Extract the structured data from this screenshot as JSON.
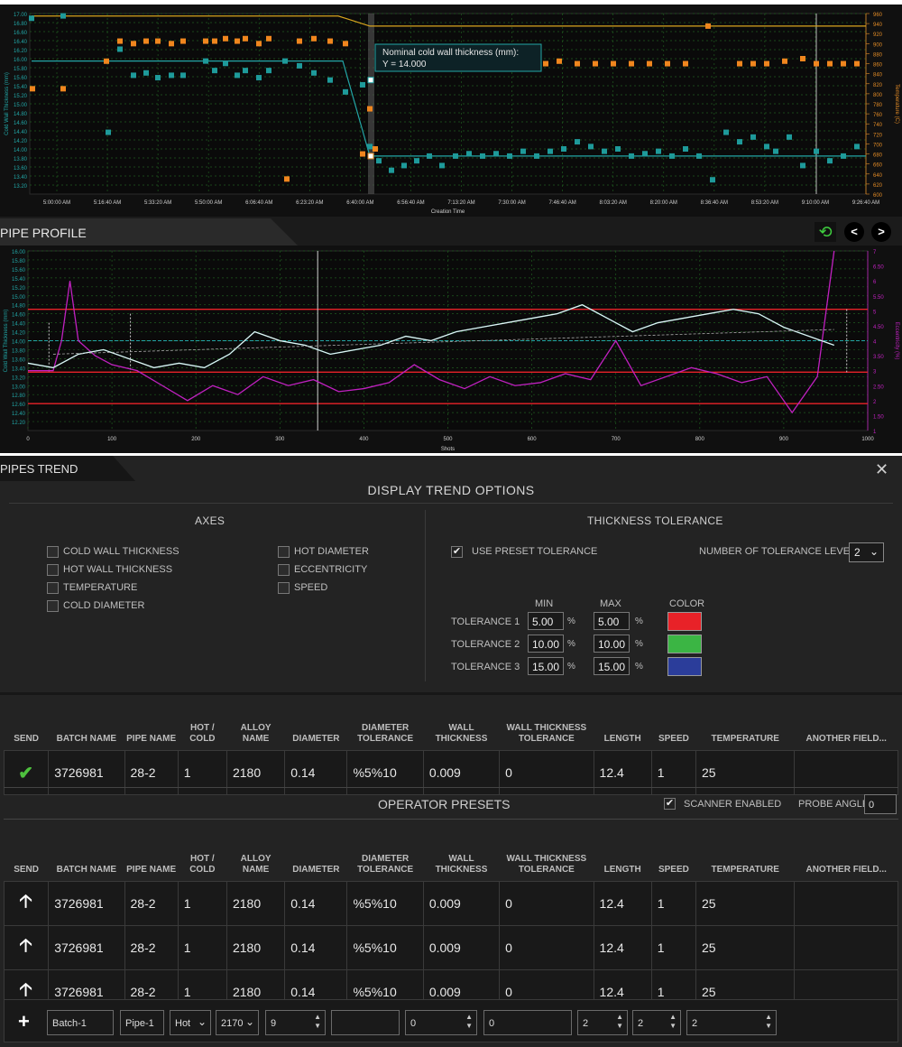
{
  "top_chart": {
    "y_left_label": "Cold Wall Thickness (mm)",
    "y_right_label": "Temperature (C)",
    "x_label": "Creation Time",
    "y_left_ticks": [
      "17.00",
      "16.80",
      "16.60",
      "16.40",
      "16.20",
      "16.00",
      "15.80",
      "15.60",
      "15.40",
      "15.20",
      "15.00",
      "14.80",
      "14.60",
      "14.40",
      "14.20",
      "14.00",
      "13.80",
      "13.60",
      "13.40",
      "13.20"
    ],
    "y_right_ticks": [
      "960",
      "940",
      "920",
      "900",
      "880",
      "860",
      "840",
      "820",
      "800",
      "780",
      "760",
      "740",
      "720",
      "700",
      "680",
      "660",
      "640",
      "620",
      "600"
    ],
    "x_ticks": [
      "5:00:00 AM",
      "5:16:40 AM",
      "5:33:20 AM",
      "5:50:00 AM",
      "6:06:40 AM",
      "6:23:20 AM",
      "6:40:00 AM",
      "6:56:40 AM",
      "7:13:20 AM",
      "7:30:00 AM",
      "7:46:40 AM",
      "8:03:20 AM",
      "8:20:00 AM",
      "8:36:40 AM",
      "8:53:20 AM",
      "9:10:00 AM",
      "9:26:40 AM"
    ],
    "tooltip_line1": "Nominal cold wall thickness (mm):",
    "tooltip_line2": "Y = 14.000",
    "colors": {
      "temperature": "#f0861e",
      "thickness": "#1e9a9a",
      "nominal": "#d9a41e",
      "nominal_thickness": "#23a5a5"
    }
  },
  "chart_data": [
    {
      "type": "scatter",
      "title": "",
      "xlabel": "Creation Time",
      "ylabel": "Cold Wall Thickness (mm)",
      "y2label": "Temperature (C)",
      "ylim": [
        13.2,
        17.0
      ],
      "y2lim": [
        600,
        960
      ],
      "series": [
        {
          "axis": "left",
          "color": "#1e9a9a",
          "x": [
            35,
            70,
            120,
            133,
            148,
            162,
            175,
            190,
            203,
            228,
            238,
            250,
            263,
            272,
            287,
            298,
            316,
            332,
            348,
            366,
            383,
            402,
            410,
            420,
            434,
            448,
            462,
            476,
            490,
            505,
            520,
            535,
            550,
            565,
            580,
            595,
            610,
            625,
            640,
            655,
            670,
            685,
            700,
            715,
            730,
            745,
            760,
            775,
            790,
            805,
            820,
            835,
            850,
            860,
            875,
            890,
            905,
            920,
            935,
            950
          ],
          "y": [
            16.9,
            16.95,
            14.5,
            16.25,
            15.7,
            15.75,
            15.65,
            15.7,
            15.7,
            16.0,
            15.8,
            15.95,
            15.7,
            15.8,
            15.65,
            15.8,
            16.0,
            15.9,
            15.75,
            15.6,
            15.35,
            15.5,
            14.2,
            13.9,
            13.7,
            13.8,
            13.9,
            14.0,
            13.8,
            14.0,
            14.05,
            14.0,
            14.05,
            14.0,
            14.1,
            14.0,
            14.1,
            14.15,
            14.3,
            14.2,
            14.1,
            14.15,
            14.0,
            14.05,
            14.1,
            14.0,
            14.15,
            14.0,
            13.5,
            14.5,
            14.3,
            14.4,
            14.2,
            14.1,
            14.4,
            13.8,
            14.1,
            13.9,
            14.0,
            14.2
          ]
        },
        {
          "axis": "right",
          "color": "#f0861e",
          "x": [
            36,
            70,
            118,
            133,
            148,
            162,
            175,
            190,
            203,
            228,
            238,
            250,
            263,
            272,
            287,
            298,
            318,
            332,
            348,
            366,
            383,
            402,
            410,
            416,
            605,
            620,
            640,
            660,
            680,
            700,
            720,
            740,
            760,
            785,
            820,
            835,
            850,
            870,
            890,
            905,
            920,
            935,
            950
          ],
          "y": [
            810,
            810,
            865,
            905,
            900,
            905,
            905,
            900,
            905,
            905,
            905,
            910,
            905,
            910,
            900,
            910,
            630,
            905,
            910,
            905,
            900,
            680,
            770,
            690,
            860,
            865,
            860,
            860,
            860,
            860,
            860,
            860,
            860,
            935,
            860,
            860,
            860,
            865,
            870,
            860,
            860,
            860,
            860
          ]
        }
      ],
      "lines": [
        {
          "name": "nominal_temperature",
          "color": "#d9a41e",
          "y_axis": "right",
          "points": [
            [
              35,
              955
            ],
            [
              375,
              955
            ],
            [
              410,
              935
            ],
            [
              960,
              935
            ]
          ]
        },
        {
          "name": "nominal_thickness",
          "color": "#23a5a5",
          "y_axis": "left",
          "points": [
            [
              35,
              16.0
            ],
            [
              380,
              16.0
            ],
            [
              410,
              14.0
            ],
            [
              960,
              14.0
            ]
          ]
        }
      ]
    },
    {
      "type": "line",
      "title": "PIPE PROFILE",
      "xlabel": "Shots",
      "ylabel": "Cold Wall Thickness (mm)",
      "y2label": "Eccentricity (%)",
      "xlim": [
        0,
        1000
      ],
      "ylim": [
        12.0,
        16.0
      ],
      "y2lim": [
        1,
        7
      ],
      "x_ticks": [
        "0",
        "100",
        "200",
        "300",
        "400",
        "500",
        "600",
        "700",
        "800",
        "900",
        "1000"
      ],
      "y_ticks": [
        "16.00",
        "15.80",
        "15.60",
        "15.40",
        "15.20",
        "15.00",
        "14.80",
        "14.60",
        "14.40",
        "14.20",
        "14.00",
        "13.80",
        "13.60",
        "13.40",
        "13.20",
        "13.00",
        "12.80",
        "12.60",
        "12.40",
        "12.20"
      ],
      "y2_ticks": [
        "7",
        "6.50",
        "6",
        "5.50",
        "5",
        "4.50",
        "4",
        "3.50",
        "3",
        "2.50",
        "2",
        "1.50",
        "1"
      ],
      "tolerance_lines": [
        14.7,
        13.3,
        14.0,
        12.6
      ],
      "series": [
        {
          "name": "Thickness",
          "color": "#e8f4f4",
          "x": [
            0,
            30,
            60,
            90,
            120,
            150,
            180,
            210,
            240,
            270,
            300,
            330,
            360,
            390,
            420,
            450,
            480,
            510,
            540,
            570,
            600,
            630,
            660,
            690,
            720,
            750,
            780,
            810,
            840,
            870,
            900,
            930,
            960
          ],
          "y": [
            13.5,
            13.4,
            13.7,
            13.8,
            13.6,
            13.4,
            13.5,
            13.4,
            13.7,
            14.2,
            14.0,
            13.9,
            13.7,
            13.8,
            13.9,
            14.1,
            14.0,
            14.2,
            14.3,
            14.4,
            14.5,
            14.6,
            14.8,
            14.5,
            14.2,
            14.4,
            14.5,
            14.6,
            14.7,
            14.6,
            14.3,
            14.1,
            13.9
          ]
        },
        {
          "name": "Eccentricity",
          "color": "#c021c0",
          "x": [
            0,
            30,
            40,
            50,
            60,
            80,
            100,
            130,
            160,
            190,
            220,
            250,
            280,
            310,
            340,
            370,
            400,
            430,
            460,
            490,
            520,
            550,
            580,
            610,
            640,
            670,
            700,
            730,
            760,
            790,
            820,
            850,
            880,
            910,
            940,
            960
          ],
          "y": [
            3,
            3,
            4,
            6,
            4,
            3.5,
            3.2,
            3,
            2.5,
            2,
            2.5,
            2.2,
            2.8,
            2.5,
            2.7,
            2.3,
            2.4,
            2.6,
            3.2,
            2.7,
            2.4,
            2.8,
            2.5,
            2.6,
            2.9,
            2.7,
            4,
            2.5,
            2.8,
            3.1,
            2.9,
            2.6,
            2.8,
            1.6,
            2.8,
            7
          ]
        }
      ]
    }
  ],
  "profile": {
    "title": "PIPE PROFILE",
    "prev": "<",
    "next": ">"
  },
  "trend": {
    "tab_title": "PIPES TREND",
    "options_title": "DISPLAY TREND OPTIONS",
    "axes_title": "AXES",
    "axes_left": [
      "COLD WALL THICKNESS",
      "HOT WALL THICKNESS",
      "TEMPERATURE",
      "COLD DIAMETER"
    ],
    "axes_right": [
      "HOT DIAMETER",
      "ECCENTRICITY",
      "SPEED"
    ],
    "tol_title": "THICKNESS TOLERANCE",
    "use_preset": "USE PRESET TOLERANCE",
    "num_levels_label": "NUMBER OF TOLERANCE LEVEL",
    "num_levels_value": "2",
    "col_min": "MIN",
    "col_max": "MAX",
    "col_color": "COLOR",
    "pct": "%",
    "tolerances": [
      {
        "label": "TOLERANCE 1",
        "min": "5.00",
        "max": "5.00",
        "color": "#e82228"
      },
      {
        "label": "TOLERANCE 2",
        "min": "10.00",
        "max": "10.00",
        "color": "#3bb544"
      },
      {
        "label": "TOLERANCE 3",
        "min": "15.00",
        "max": "15.00",
        "color": "#2b3d9a"
      }
    ]
  },
  "columns": [
    "SEND",
    "BATCH NAME",
    "PIPE NAME",
    "HOT / COLD",
    "ALLOY NAME",
    "DIAMETER",
    "DIAMETER TOLERANCE",
    "WALL THICKNESS",
    "WALL THICKNESS TOLERANCE",
    "LENGTH",
    "SPEED",
    "TEMPERATURE",
    "ANOTHER FIELD..."
  ],
  "current_row": [
    "3726981",
    "28-2",
    "1",
    "2180",
    "0.14",
    "%5%10",
    "0.009",
    "0",
    "12.4",
    "1",
    "25",
    ""
  ],
  "presets": {
    "title": "OPERATOR PRESETS",
    "scanner_label": "SCANNER ENABLED",
    "probe_label": "PROBE ANGLE",
    "probe_value": "0",
    "rows": [
      [
        "3726981",
        "28-2",
        "1",
        "2180",
        "0.14",
        "%5%10",
        "0.009",
        "0",
        "12.4",
        "1",
        "25",
        ""
      ],
      [
        "3726981",
        "28-2",
        "1",
        "2180",
        "0.14",
        "%5%10",
        "0.009",
        "0",
        "12.4",
        "1",
        "25",
        ""
      ],
      [
        "3726981",
        "28-2",
        "1",
        "2180",
        "0.14",
        "%5%10",
        "0.009",
        "0",
        "12.4",
        "1",
        "25",
        ""
      ]
    ]
  },
  "new_row": {
    "batch": "Batch-1",
    "pipe": "Pipe-1",
    "hotcold": "Hot",
    "alloy": "2170",
    "diameter": "9",
    "diam_tol": "",
    "wall": "0",
    "wall_tol": "0",
    "length": "2",
    "speed": "2",
    "temperature": "2"
  }
}
